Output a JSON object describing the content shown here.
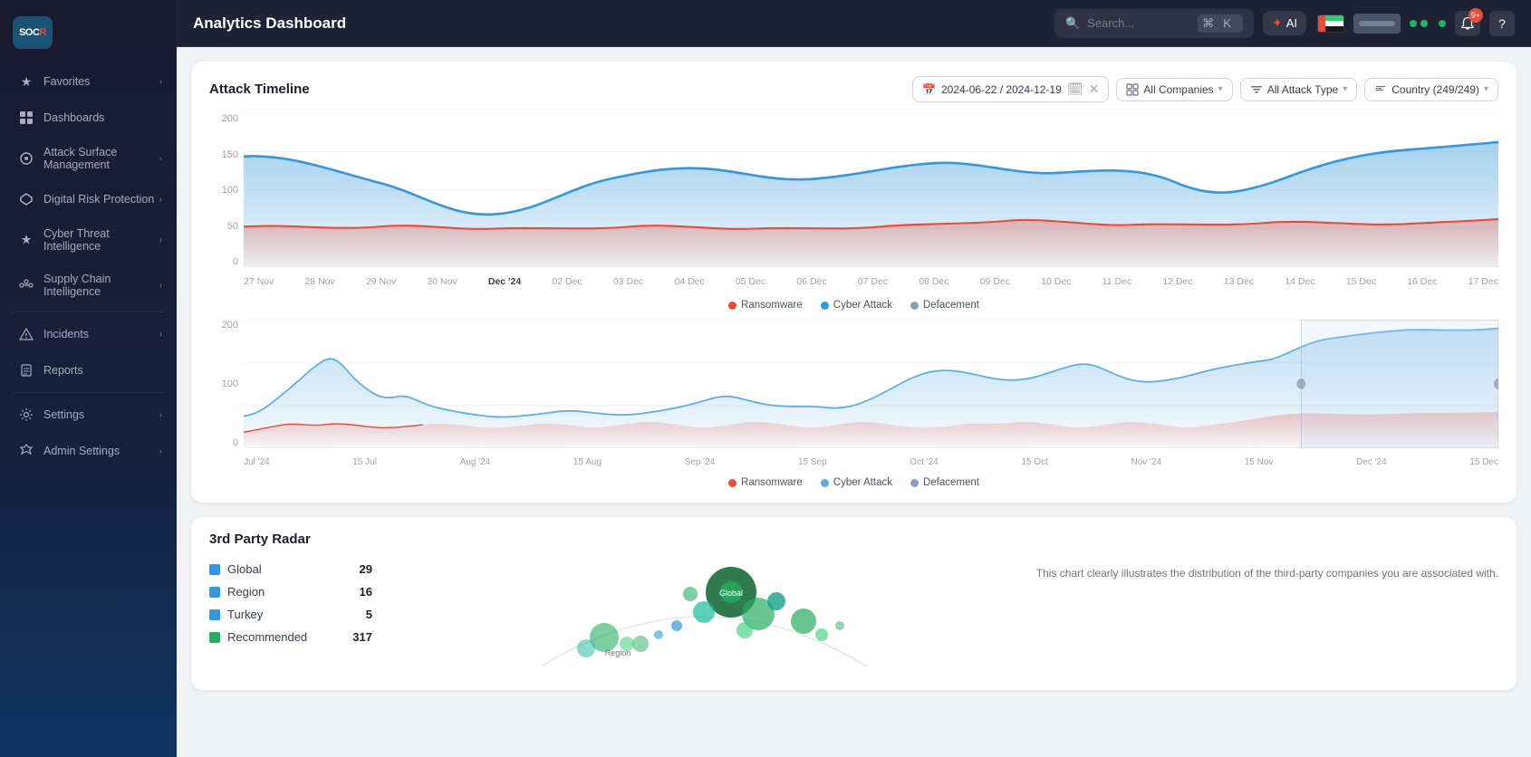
{
  "sidebar": {
    "logo": "SOCRadar",
    "items": [
      {
        "id": "favorites",
        "label": "Favorites",
        "icon": "★",
        "hasChevron": true
      },
      {
        "id": "dashboards",
        "label": "Dashboards",
        "icon": "⊞",
        "hasChevron": false
      },
      {
        "id": "attack-surface",
        "label": "Attack Surface Management",
        "icon": "⊙",
        "hasChevron": true
      },
      {
        "id": "digital-risk",
        "label": "Digital Risk Protection",
        "icon": "◈",
        "hasChevron": true
      },
      {
        "id": "cyber-threat",
        "label": "Cyber Threat Intelligence",
        "icon": "⚡",
        "hasChevron": true
      },
      {
        "id": "supply-chain",
        "label": "Supply Chain Intelligence",
        "icon": "🔗",
        "hasChevron": true
      },
      {
        "id": "incidents",
        "label": "Incidents",
        "icon": "⚑",
        "hasChevron": true
      },
      {
        "id": "reports",
        "label": "Reports",
        "icon": "📄",
        "hasChevron": false
      },
      {
        "id": "settings",
        "label": "Settings",
        "icon": "⚙",
        "hasChevron": true
      },
      {
        "id": "admin",
        "label": "Admin Settings",
        "icon": "🛡",
        "hasChevron": true
      }
    ]
  },
  "header": {
    "title": "Analytics Dashboard",
    "search_placeholder": "Search...",
    "shortcut_key": "⌘",
    "shortcut_letter": "K",
    "ai_label": "AI"
  },
  "attack_timeline": {
    "title": "Attack Timeline",
    "date_range": "2024-06-22 / 2024-12-19",
    "filters": {
      "companies": "All Companies",
      "attack_type": "All Attack Type",
      "country": "Country (249/249)"
    },
    "legend": [
      {
        "label": "Ransomware",
        "color": "#e74c3c"
      },
      {
        "label": "Cyber Attack",
        "color": "#3498db"
      },
      {
        "label": "Defacement",
        "color": "#8b9dc3"
      }
    ],
    "y_labels": [
      "200",
      "150",
      "100",
      "50",
      "0"
    ],
    "x_labels_main": [
      "27 Nov",
      "28 Nov",
      "29 Nov",
      "30 Nov",
      "Dec '24",
      "02 Dec",
      "03 Dec",
      "04 Dec",
      "05 Dec",
      "06 Dec",
      "07 Dec",
      "08 Dec",
      "09 Dec",
      "10 Dec",
      "11 Dec",
      "12 Dec",
      "13 Dec",
      "14 Dec",
      "15 Dec",
      "16 Dec",
      "17 Dec"
    ],
    "x_labels_mini": [
      "Jul '24",
      "15 Jul",
      "Aug '24",
      "15 Aug",
      "Sep '24",
      "15 Sep",
      "Oct '24",
      "15 Oct",
      "Nov '24",
      "15 Nov",
      "Dec '24",
      "15 Dec"
    ]
  },
  "third_party_radar": {
    "title": "3rd Party Radar",
    "legend": [
      {
        "label": "Global",
        "count": 29,
        "color": "#3498db"
      },
      {
        "label": "Region",
        "count": 16,
        "color": "#3498db"
      },
      {
        "label": "Turkey",
        "count": 5,
        "color": "#3498db"
      },
      {
        "label": "Recommended",
        "count": 317,
        "color": "#27ae60"
      }
    ],
    "description": "This chart clearly illustrates the distribution of the third-party companies you are associated with.",
    "bubble_labels": [
      "Global",
      "Region"
    ]
  }
}
